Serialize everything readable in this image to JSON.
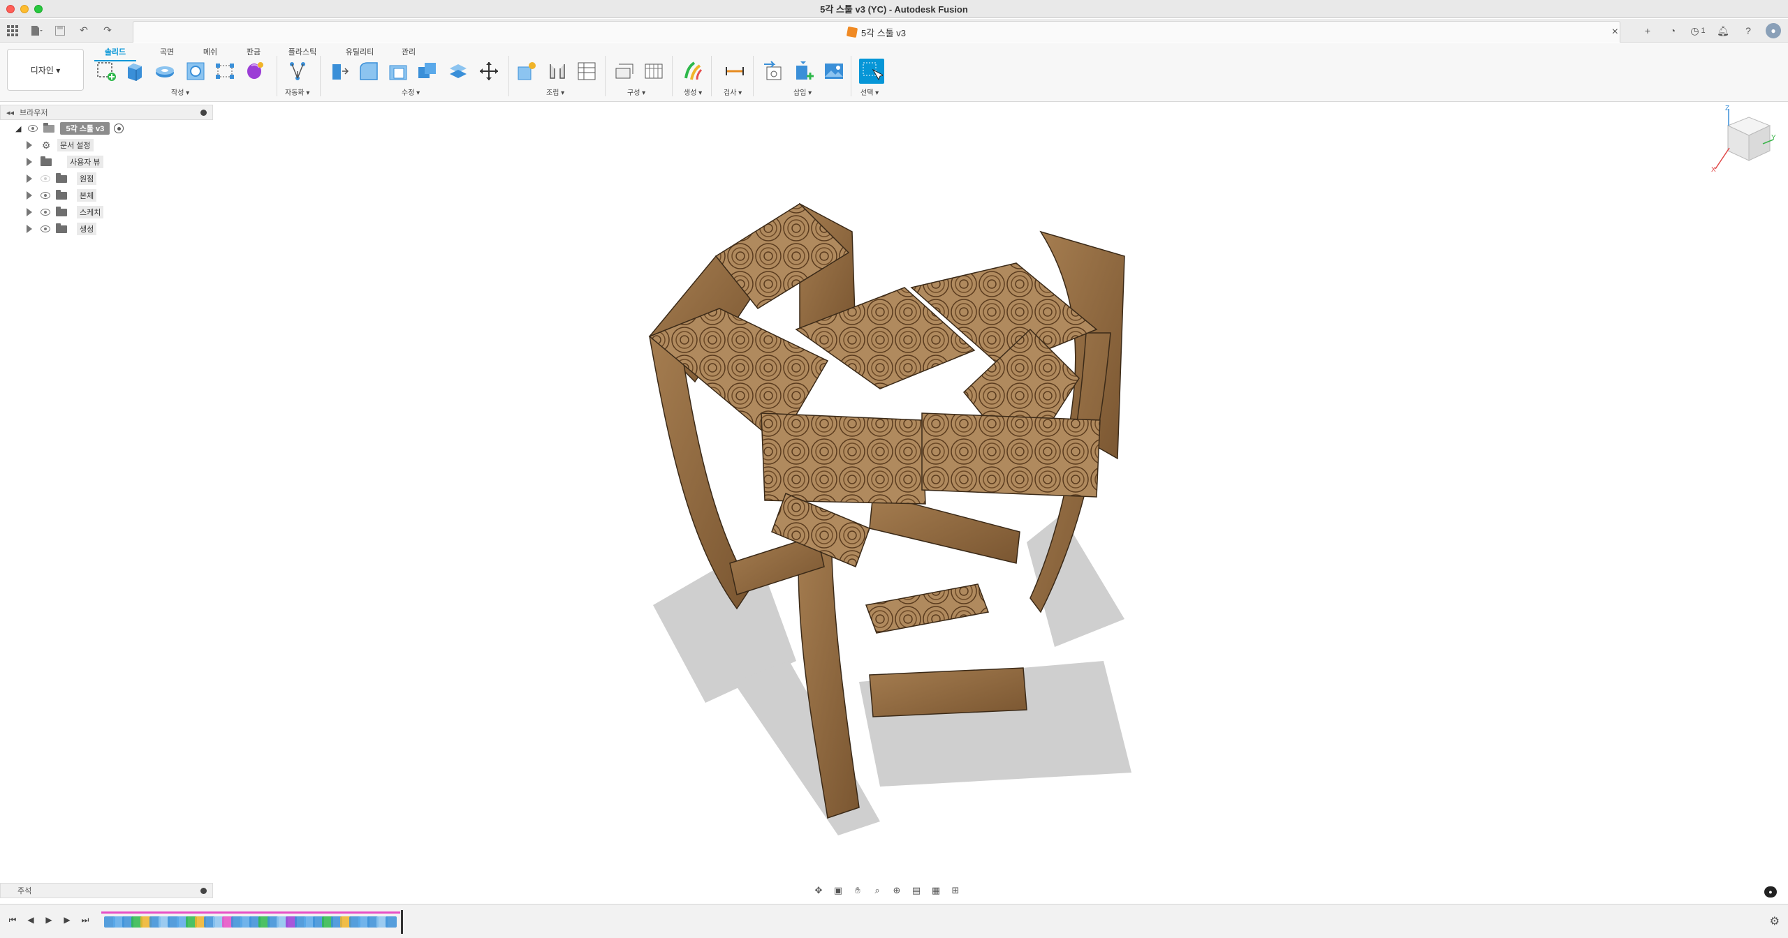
{
  "window": {
    "title": "5각 스툴 v3 (YC) - Autodesk Fusion"
  },
  "document_tab": {
    "label": "5각 스툴 v3"
  },
  "toolbar_right": {
    "job_count": "1"
  },
  "workspace": {
    "label": "디자인 ▾"
  },
  "ribbon_tabs": [
    {
      "label": "솔리드",
      "active": true
    },
    {
      "label": "곡면"
    },
    {
      "label": "메쉬"
    },
    {
      "label": "판금"
    },
    {
      "label": "플라스틱"
    },
    {
      "label": "유틸리티"
    },
    {
      "label": "관리"
    }
  ],
  "groups": {
    "create": "작성 ▾",
    "automate": "자동화 ▾",
    "modify": "수정 ▾",
    "assemble": "조립 ▾",
    "construct": "구성 ▾",
    "generate": "생성 ▾",
    "inspect": "검사 ▾",
    "insert": "삽입 ▾",
    "select": "선택 ▾"
  },
  "browser": {
    "title": "브라우저",
    "root": "5각 스툴 v3",
    "items": [
      {
        "label": "문서 설정",
        "icon": "gear-icon",
        "eye": false
      },
      {
        "label": "사용자 뷰",
        "icon": "folder-icon",
        "eye": false
      },
      {
        "label": "원점",
        "icon": "folder-icon",
        "eye": true,
        "faded": true
      },
      {
        "label": "본체",
        "icon": "folder-icon",
        "eye": true
      },
      {
        "label": "스케치",
        "icon": "folder-icon",
        "eye": true
      },
      {
        "label": "생성",
        "icon": "folder-icon",
        "eye": true
      }
    ]
  },
  "viewcube": {
    "axis_x": "X",
    "axis_y": "Y",
    "axis_z": "Z"
  },
  "comments": {
    "label": "주석"
  },
  "colors": {
    "accent": "#0696d7",
    "wood": "#a8825a",
    "timeline_pink": "#e64fc6"
  }
}
